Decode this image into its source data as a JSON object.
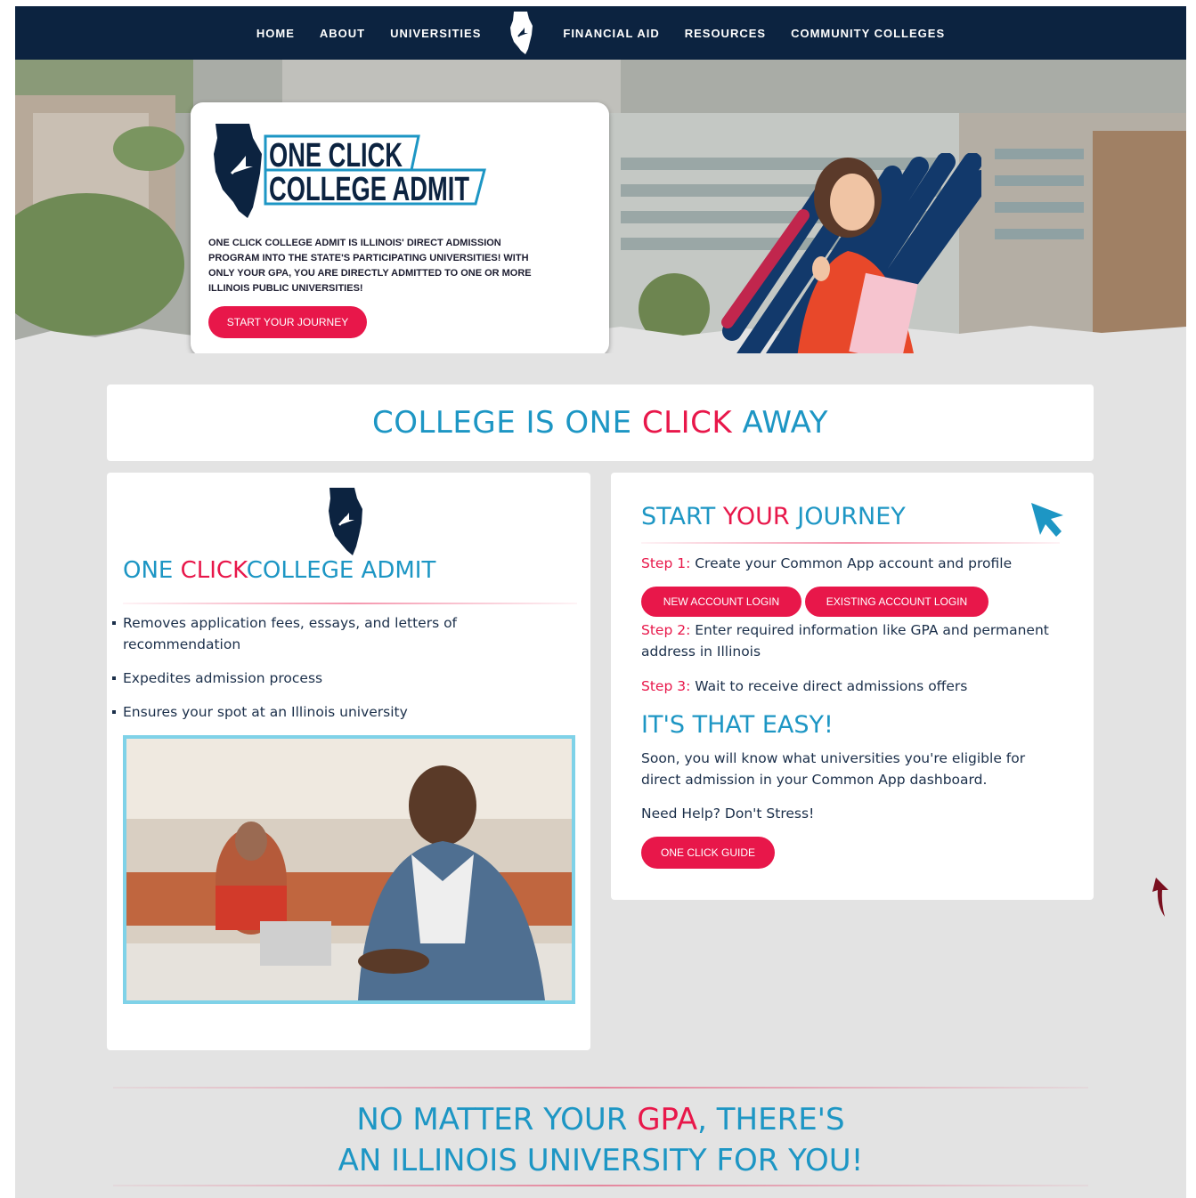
{
  "nav": {
    "items_left": [
      "HOME",
      "ABOUT",
      "UNIVERSITIES"
    ],
    "items_right": [
      "FINANCIAL AID",
      "RESOURCES",
      "COMMUNITY COLLEGES"
    ]
  },
  "hero": {
    "logo_line1": "ONE CLICK",
    "logo_line2": "COLLEGE ADMIT",
    "description": "ONE CLICK COLLEGE ADMIT IS ILLINOIS' DIRECT ADMISSION PROGRAM INTO THE STATE'S PARTICIPATING UNIVERSITIES! WITH ONLY YOUR GPA, YOU ARE DIRECTLY ADMITTED TO ONE OR MORE ILLINOIS PUBLIC UNIVERSITIES!",
    "cta": "START YOUR JOURNEY"
  },
  "tagline": {
    "part1": "COLLEGE IS ONE ",
    "part2": "CLICK",
    "part3": " AWAY"
  },
  "left_card": {
    "title_part1": "ONE ",
    "title_part2": "CLICK",
    "title_part3": "COLLEGE ADMIT",
    "bullets": [
      "Removes application fees, essays, and letters of recommendation",
      "Expedites admission process",
      "Ensures your spot at an Illinois university"
    ]
  },
  "right_card": {
    "title_part1": "START ",
    "title_part2": "YOUR",
    "title_part3": " JOURNEY",
    "step1_label": "Step 1:",
    "step1_text": " Create your Common App account and profile",
    "btn_new": "NEW ACCOUNT LOGIN",
    "btn_existing": "EXISTING ACCOUNT LOGIN",
    "step2_label": "Step 2:",
    "step2_text": " Enter required information like GPA and permanent address in Illinois",
    "step3_label": "Step 3:",
    "step3_text": " Wait to receive direct admissions offers",
    "easy_heading": "IT'S THAT EASY!",
    "soon_text": "Soon, you will know what universities you're eligible for direct admission in your Common App dashboard.",
    "help_text": "Need Help? Don't Stress!",
    "btn_guide": "ONE CLICK GUIDE"
  },
  "bottom": {
    "line1_part1": "NO MATTER YOUR ",
    "line1_part2": "GPA",
    "line1_part3": ", THERE'S",
    "line2": "AN ILLINOIS UNIVERSITY FOR YOU!"
  },
  "colors": {
    "navy": "#0c2340",
    "brand_blue": "#1d96c4",
    "accent_red": "#e8174a",
    "background": "#e3e3e3"
  },
  "icons": [
    "illinois-state-logo-icon",
    "cursor-arrow-icon",
    "scroll-arrow-icon"
  ]
}
